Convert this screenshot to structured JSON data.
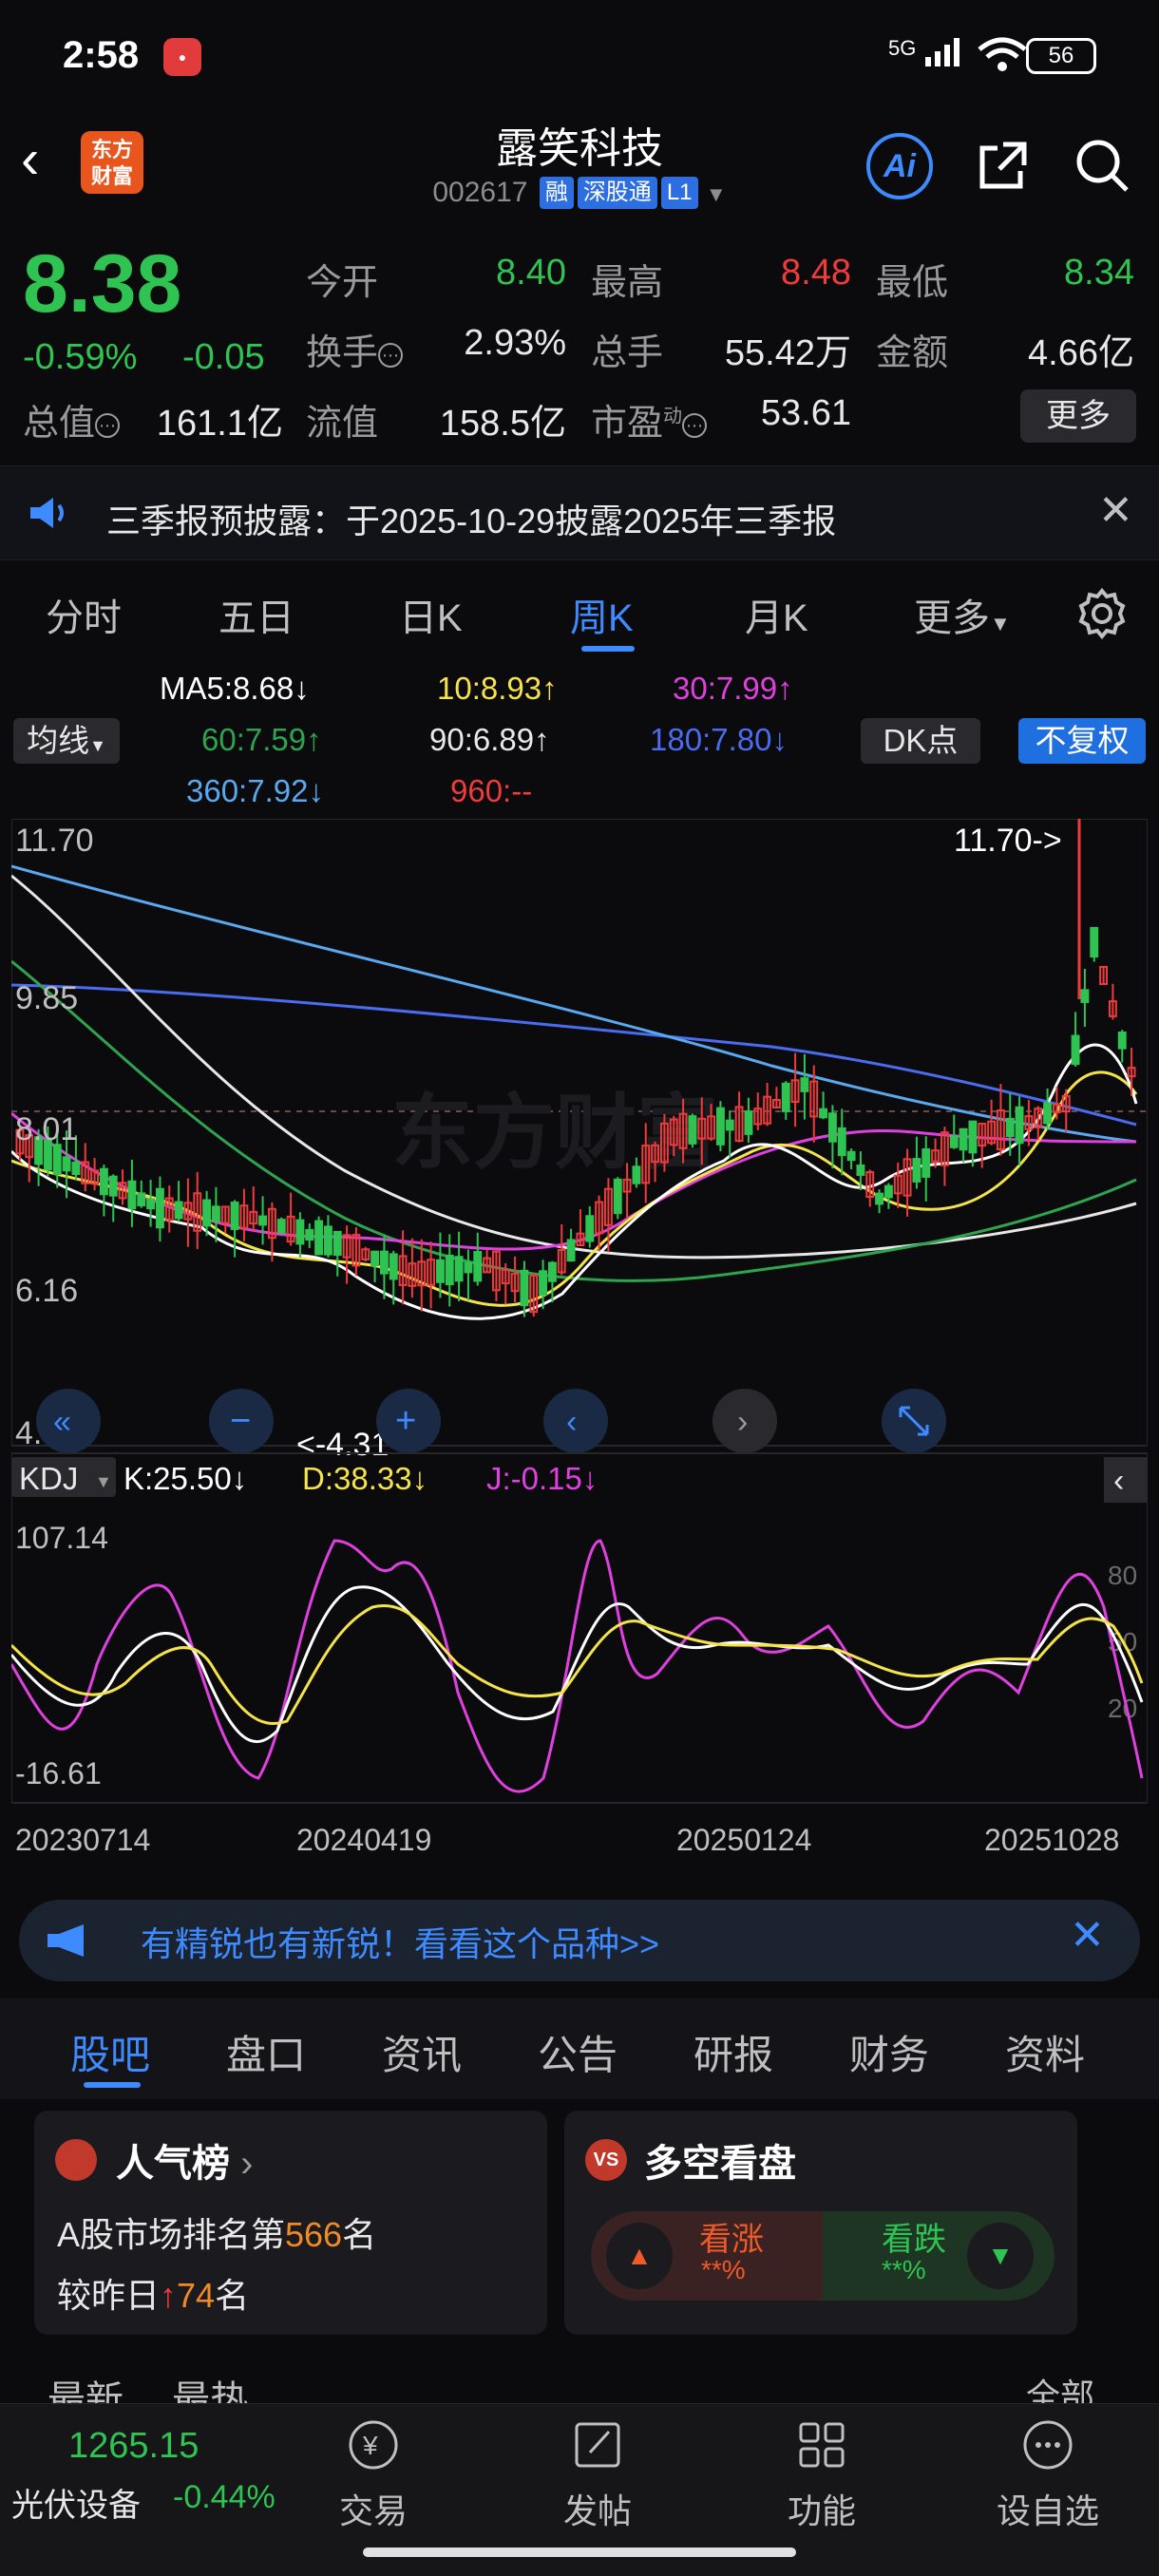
{
  "status": {
    "time": "2:58",
    "network": "5G",
    "battery": "56"
  },
  "header": {
    "logo_line1": "东方",
    "logo_line2": "财富",
    "name": "露笑科技",
    "code": "002617",
    "tags": [
      "融",
      "深股通",
      "L1"
    ],
    "ai_label": "Ai"
  },
  "quote": {
    "price": "8.38",
    "change_pct": "-0.59%",
    "change": "-0.05",
    "rows": [
      [
        {
          "label": "今开",
          "value": "8.40",
          "color": "down"
        },
        {
          "label": "最高",
          "value": "8.48",
          "color": "up"
        },
        {
          "label": "最低",
          "value": "8.34",
          "color": "down"
        }
      ],
      [
        {
          "label": "换手",
          "value": "2.93%",
          "color": "white"
        },
        {
          "label": "总手",
          "value": "55.42万",
          "color": "white"
        },
        {
          "label": "金额",
          "value": "4.66亿",
          "color": "white"
        }
      ],
      [
        {
          "label": "总值",
          "value": "161.1亿",
          "color": "white"
        },
        {
          "label": "流值",
          "value": "158.5亿",
          "color": "white"
        },
        {
          "label": "市盈",
          "value": "53.61",
          "color": "white"
        }
      ]
    ],
    "pe_sup": "动",
    "more": "更多"
  },
  "notice": {
    "text": "三季报预披露：于2025-10-29披露2025年三季报"
  },
  "period_tabs": [
    "分时",
    "五日",
    "日K",
    "周K",
    "月K",
    "更多"
  ],
  "active_period": "周K",
  "ma": {
    "ma5": "MA5:8.68↓",
    "ma10": "10:8.93↑",
    "ma30": "30:7.99↑",
    "ma60": "60:7.59↑",
    "ma90": "90:6.89↑",
    "ma180": "180:7.80↓",
    "ma360": "360:7.92↓",
    "ma960": "960:--",
    "junxian": "均线",
    "dk": "DK点",
    "fuquan": "不复权"
  },
  "kline": {
    "y_labels": [
      "11.70",
      "9.85",
      "8.01",
      "6.16",
      "4.31"
    ],
    "high_note": "11.70->",
    "low_note": "<-4.31",
    "watermark": "东方财富"
  },
  "kdj": {
    "label": "KDJ",
    "k": "K:25.50↓",
    "d": "D:38.33↓",
    "j": "J:-0.15↓",
    "y_top": "107.14",
    "y_bottom": "-16.61",
    "ref_lines": [
      "80",
      "50",
      "20"
    ]
  },
  "dates": [
    "20230714",
    "20240419",
    "20250124",
    "20251028"
  ],
  "colors": {
    "up": "#ef3b3b",
    "down": "#2fc352",
    "accent": "#3d8bff",
    "ma5": "#ffffff",
    "ma10": "#f5e34a",
    "ma30": "#e040e0",
    "ma60": "#2ea44f",
    "ma90": "#e8e8e8",
    "ma180": "#4a6cf0",
    "ma360": "#5aa8f0"
  },
  "promo": {
    "text": "有精锐也有新锐！看看这个品种>>"
  },
  "content_tabs": [
    "股吧",
    "盘口",
    "资讯",
    "公告",
    "研报",
    "财务",
    "资料"
  ],
  "rank_card": {
    "title": "人气榜",
    "line1_a": "A股市场排名第",
    "line1_num": "566",
    "line1_b": "名",
    "line2_a": "较昨日",
    "line2_num": "74",
    "line2_b": "名"
  },
  "vs_card": {
    "icon": "VS",
    "title": "多空看盘",
    "bull": "看涨",
    "bear": "看跌",
    "bull_pct": "**%",
    "bear_pct": "**%"
  },
  "feed": {
    "latest": "最新",
    "hot": "最热",
    "all": "全部"
  },
  "bottom": {
    "index_value": "1265.15",
    "index_name": "光伏设备",
    "index_change": "-0.44%",
    "nav": [
      "交易",
      "发帖",
      "功能",
      "设自选"
    ]
  }
}
